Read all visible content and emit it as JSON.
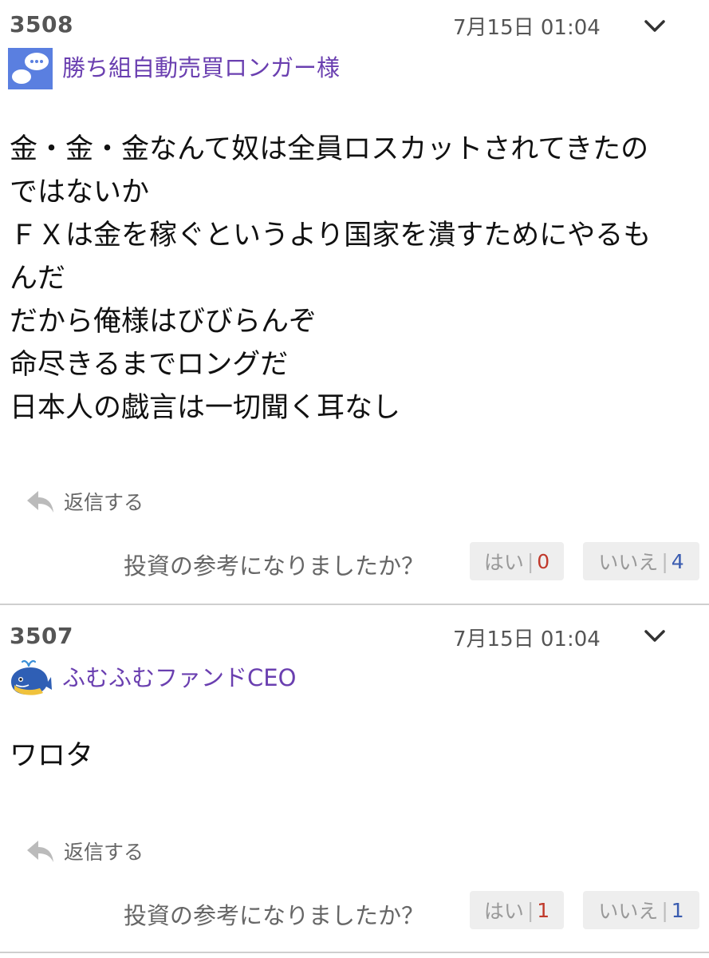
{
  "posts": [
    {
      "number": "3508",
      "timestamp": "7月15日 01:04",
      "avatar_icon": "speech-bubble-icon",
      "username": "勝ち組自動売買ロンガー様",
      "body_lines": [
        "金・金・金なんて奴は全員ロスカットされてきたの",
        "ではないか",
        "ＦＸは金を稼ぐというより国家を潰すためにやるも",
        "んだ",
        "だから俺様はびびらんぞ",
        "命尽きるまでロングだ",
        "日本人の戯言は一切聞く耳なし"
      ],
      "reply_label": "返信する",
      "question": "投資の参考になりましたか？",
      "yes_label": "はい",
      "yes_count": "0",
      "no_label": "いいえ",
      "no_count": "4"
    },
    {
      "number": "3507",
      "timestamp": "7月15日 01:04",
      "avatar_icon": "whale-icon",
      "username": "ふむふむファンドCEO",
      "body_lines": [
        "ワロタ"
      ],
      "reply_label": "返信する",
      "question": "投資の参考になりましたか？",
      "yes_label": "はい",
      "yes_count": "1",
      "no_label": "いいえ",
      "no_count": "1"
    }
  ],
  "colors": {
    "username": "#6a3fb0",
    "yes_count": "#c0392b",
    "no_count": "#3a5cb0",
    "divider": "#cfcfcf"
  }
}
